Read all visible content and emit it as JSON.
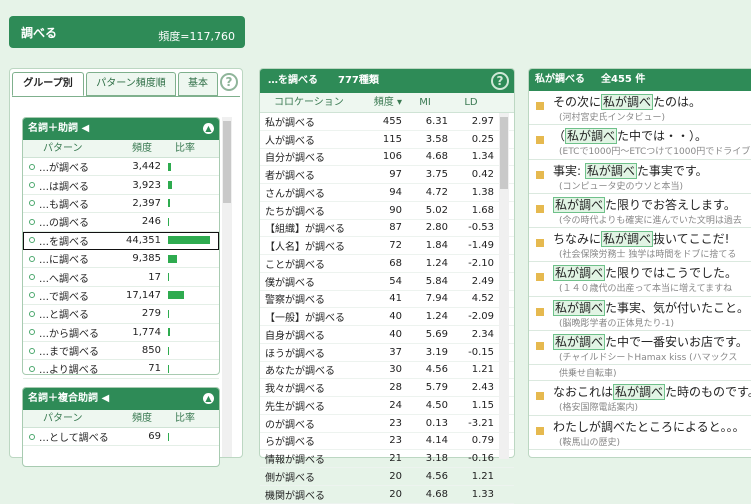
{
  "header": {
    "title": "調べる",
    "frequency": "頻度=117,760"
  },
  "left": {
    "tabs": [
      {
        "label": "グループ別",
        "active": true
      },
      {
        "label": "パターン頻度順",
        "active": false
      },
      {
        "label": "基本",
        "active": false
      }
    ],
    "help": "?",
    "sections": [
      {
        "title": "名詞＋助詞 ◀",
        "columns": [
          "パターン",
          "頻度",
          "比率"
        ],
        "rows": [
          {
            "pattern": "…が調べる",
            "freq": "3,442",
            "ratio": 0.078
          },
          {
            "pattern": "…は調べる",
            "freq": "3,923",
            "ratio": 0.088
          },
          {
            "pattern": "…も調べる",
            "freq": "2,397",
            "ratio": 0.054
          },
          {
            "pattern": "…の調べる",
            "freq": "246",
            "ratio": 0.006
          },
          {
            "pattern": "…を調べる",
            "freq": "44,351",
            "ratio": 1.0,
            "selected": true
          },
          {
            "pattern": "…に調べる",
            "freq": "9,385",
            "ratio": 0.212
          },
          {
            "pattern": "…へ調べる",
            "freq": "17",
            "ratio": 0.001
          },
          {
            "pattern": "…で調べる",
            "freq": "17,147",
            "ratio": 0.387
          },
          {
            "pattern": "…と調べる",
            "freq": "279",
            "ratio": 0.006
          },
          {
            "pattern": "…から調べる",
            "freq": "1,774",
            "ratio": 0.04
          },
          {
            "pattern": "…まで調べる",
            "freq": "850",
            "ratio": 0.019
          },
          {
            "pattern": "…より調べる",
            "freq": "71",
            "ratio": 0.002
          }
        ]
      },
      {
        "title": "名詞＋複合助詞 ◀",
        "columns": [
          "パターン",
          "頻度",
          "比率"
        ],
        "rows": [
          {
            "pattern": "…として調べる",
            "freq": "69",
            "ratio": 0.002
          }
        ]
      }
    ]
  },
  "middle": {
    "title": "…を調べる",
    "count": "777種類",
    "help": "?",
    "columns": [
      "コロケーション",
      "頻度 ▾",
      "MI",
      "LD"
    ],
    "rows": [
      {
        "coll": "私が調べる",
        "freq": "455",
        "mi": "6.31",
        "ld": "2.97"
      },
      {
        "coll": "人が調べる",
        "freq": "115",
        "mi": "3.58",
        "ld": "0.25"
      },
      {
        "coll": "自分が調べる",
        "freq": "106",
        "mi": "4.68",
        "ld": "1.34"
      },
      {
        "coll": "者が調べる",
        "freq": "97",
        "mi": "3.75",
        "ld": "0.42"
      },
      {
        "coll": "さんが調べる",
        "freq": "94",
        "mi": "4.72",
        "ld": "1.38"
      },
      {
        "coll": "たちが調べる",
        "freq": "90",
        "mi": "5.02",
        "ld": "1.68"
      },
      {
        "coll": "【組織】が調べる",
        "freq": "87",
        "mi": "2.80",
        "ld": "-0.53"
      },
      {
        "coll": "【人名】が調べる",
        "freq": "72",
        "mi": "1.84",
        "ld": "-1.49"
      },
      {
        "coll": "ことが調べる",
        "freq": "68",
        "mi": "1.24",
        "ld": "-2.10"
      },
      {
        "coll": "僕が調べる",
        "freq": "54",
        "mi": "5.84",
        "ld": "2.49"
      },
      {
        "coll": "警察が調べる",
        "freq": "41",
        "mi": "7.94",
        "ld": "4.52"
      },
      {
        "coll": "【一般】が調べる",
        "freq": "40",
        "mi": "1.24",
        "ld": "-2.09"
      },
      {
        "coll": "自身が調べる",
        "freq": "40",
        "mi": "5.69",
        "ld": "2.34"
      },
      {
        "coll": "ほうが調べる",
        "freq": "37",
        "mi": "3.19",
        "ld": "-0.15"
      },
      {
        "coll": "あなたが調べる",
        "freq": "30",
        "mi": "4.56",
        "ld": "1.21"
      },
      {
        "coll": "我々が調べる",
        "freq": "28",
        "mi": "5.79",
        "ld": "2.43"
      },
      {
        "coll": "先生が調べる",
        "freq": "24",
        "mi": "4.50",
        "ld": "1.15"
      },
      {
        "coll": "のが調べる",
        "freq": "23",
        "mi": "0.13",
        "ld": "-3.21"
      },
      {
        "coll": "らが調べる",
        "freq": "23",
        "mi": "4.14",
        "ld": "0.79"
      },
      {
        "coll": "情報が調べる",
        "freq": "21",
        "mi": "3.18",
        "ld": "-0.16"
      },
      {
        "coll": "側が調べる",
        "freq": "20",
        "mi": "4.56",
        "ld": "1.21"
      },
      {
        "coll": "機関が調べる",
        "freq": "20",
        "mi": "4.68",
        "ld": "1.33"
      }
    ]
  },
  "right": {
    "title": "私が調べる",
    "count": "全455 件",
    "examples": [
      {
        "before": "その次に",
        "hl": "私が調べ",
        "after": "たのは。",
        "src": "(河村宮史氏インタビュー)"
      },
      {
        "before": "（",
        "hl": "私が調べ",
        "after": "た中では・・）。",
        "src": "(ETCで1000円～ETCつけて1000円でドライブ"
      },
      {
        "before": "事実: ",
        "hl": "私が調べ",
        "after": "た事実です。",
        "src": "(コンピュータ史のウソと本当)"
      },
      {
        "before": "",
        "hl": "私が調べ",
        "after": "た限りでお答えします。",
        "src": "(今の時代よりも確実に進んでいた文明は過去"
      },
      {
        "before": "ちなみに",
        "hl": "私が調べ",
        "after": "抜いてここだ!",
        "src": "(社会保険労務士 独学は時間をドブに捨てる"
      },
      {
        "before": "",
        "hl": "私が調べ",
        "after": "た限りではこうでした。",
        "src": "(１４０歳代の出産って本当に増えてますね"
      },
      {
        "before": "",
        "hl": "私が調べ",
        "after": "た事実、気が付いたこと。",
        "src": "(脳晩彫学者の正体見たり-1)"
      },
      {
        "before": "",
        "hl": "私が調べ",
        "after": "た中で一番安いお店です。",
        "src": "(チャイルドシートHamax kiss (ハマックス"
      },
      {
        "before": "",
        "hl": "",
        "after": "",
        "src": "供乗せ自転車)"
      },
      {
        "before": "なおこれは",
        "hl": "私が調べ",
        "after": "た時のものです。",
        "src": "(格安国際電話案内)"
      },
      {
        "before": "わたしが調べ",
        "hl": "",
        "after": "たところによると。。。",
        "src": "(鞍馬山の歴史)"
      }
    ]
  }
}
